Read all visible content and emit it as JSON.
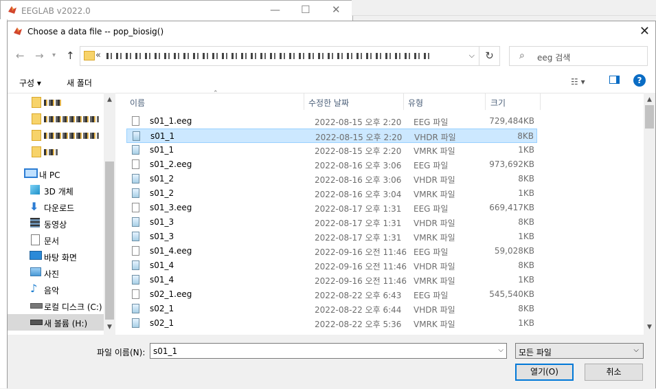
{
  "background_window": {
    "title": "EEGLAB v2022.0"
  },
  "dialog": {
    "title": "Choose a data file -- pop_biosig()"
  },
  "nav": {
    "back_icon": "arrow-left-icon",
    "forward_icon": "arrow-right-icon",
    "up_icon": "arrow-up-icon",
    "address_prefix": "«",
    "refresh_icon": "refresh-icon",
    "search_placeholder": "eeg 검색"
  },
  "toolbar": {
    "organize_label": "구성 ▾",
    "new_folder_label": "새 폴더",
    "help_label": "?"
  },
  "sidebar": {
    "items": [
      {
        "label": "내 PC",
        "icon": "pc-icon"
      },
      {
        "label": "3D 개체",
        "icon": "3d-objects-icon"
      },
      {
        "label": "다운로드",
        "icon": "download-icon"
      },
      {
        "label": "동영상",
        "icon": "video-icon"
      },
      {
        "label": "문서",
        "icon": "document-icon"
      },
      {
        "label": "바탕 화면",
        "icon": "desktop-icon"
      },
      {
        "label": "사진",
        "icon": "pictures-icon"
      },
      {
        "label": "음악",
        "icon": "music-icon"
      },
      {
        "label": "로컬 디스크 (C:)",
        "icon": "drive-icon"
      },
      {
        "label": "새 볼륨 (H:)",
        "icon": "drive-icon"
      }
    ]
  },
  "columns": {
    "name": "이름",
    "date": "수정한 날짜",
    "type": "유형",
    "size": "크기"
  },
  "files": [
    {
      "name": "s01_1.eeg",
      "date": "2022-08-15 오후 2:20",
      "type": "EEG 파일",
      "size": "729,484KB"
    },
    {
      "name": "s01_1",
      "date": "2022-08-15 오후 2:20",
      "type": "VHDR 파일",
      "size": "8KB"
    },
    {
      "name": "s01_1",
      "date": "2022-08-15 오후 2:20",
      "type": "VMRK 파일",
      "size": "1KB"
    },
    {
      "name": "s01_2.eeg",
      "date": "2022-08-16 오후 3:06",
      "type": "EEG 파일",
      "size": "973,692KB"
    },
    {
      "name": "s01_2",
      "date": "2022-08-16 오후 3:06",
      "type": "VHDR 파일",
      "size": "8KB"
    },
    {
      "name": "s01_2",
      "date": "2022-08-16 오후 3:04",
      "type": "VMRK 파일",
      "size": "1KB"
    },
    {
      "name": "s01_3.eeg",
      "date": "2022-08-17 오후 1:31",
      "type": "EEG 파일",
      "size": "669,417KB"
    },
    {
      "name": "s01_3",
      "date": "2022-08-17 오후 1:31",
      "type": "VHDR 파일",
      "size": "8KB"
    },
    {
      "name": "s01_3",
      "date": "2022-08-17 오후 1:31",
      "type": "VMRK 파일",
      "size": "1KB"
    },
    {
      "name": "s01_4.eeg",
      "date": "2022-09-16 오전 11:46",
      "type": "EEG 파일",
      "size": "59,028KB"
    },
    {
      "name": "s01_4",
      "date": "2022-09-16 오전 11:46",
      "type": "VHDR 파일",
      "size": "8KB"
    },
    {
      "name": "s01_4",
      "date": "2022-09-16 오전 11:46",
      "type": "VMRK 파일",
      "size": "1KB"
    },
    {
      "name": "s02_1.eeg",
      "date": "2022-08-22 오후 6:43",
      "type": "EEG 파일",
      "size": "545,540KB"
    },
    {
      "name": "s02_1",
      "date": "2022-08-22 오후 6:44",
      "type": "VHDR 파일",
      "size": "8KB"
    },
    {
      "name": "s02_1",
      "date": "2022-08-22 오후 5:36",
      "type": "VMRK 파일",
      "size": "1KB"
    }
  ],
  "footer": {
    "filename_label": "파일 이름(N):",
    "filename_value": "s01_1",
    "filetype_value": "모든 파일",
    "open_label": "열기(O)",
    "cancel_label": "취소"
  },
  "colors": {
    "selection_bg": "#cce8ff",
    "selection_border": "#99d1ff",
    "primary_border": "#0078d7"
  }
}
